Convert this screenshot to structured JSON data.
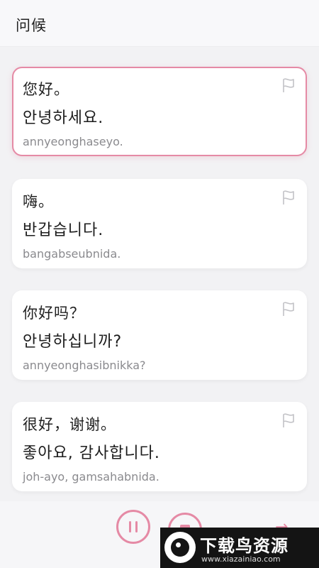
{
  "header": {
    "title": "问候"
  },
  "phrases": [
    {
      "zh": "您好。",
      "ko": "안녕하세요.",
      "roman": "annyeonghaseyo.",
      "selected": true
    },
    {
      "zh": "嗨。",
      "ko": "반갑습니다.",
      "roman": "bangabseubnida.",
      "selected": false
    },
    {
      "zh": "你好吗？",
      "ko": "안녕하십니까?",
      "roman": "annyeonghasibnikka?",
      "selected": false
    },
    {
      "zh": "很好，谢谢。",
      "ko": "좋아요, 감사합니다.",
      "roman": "joh-ayo, gamsahabnida.",
      "selected": false
    }
  ],
  "controls": {
    "pause_icon": "pause-icon",
    "stop_icon": "stop-icon",
    "next_icon": "arrow-right-icon"
  },
  "watermark": {
    "title": "下载鸟资源",
    "url": "www.xiazainiao.com"
  },
  "colors": {
    "accent": "#e58aa5",
    "background": "#f2f2f4",
    "card": "#ffffff"
  }
}
